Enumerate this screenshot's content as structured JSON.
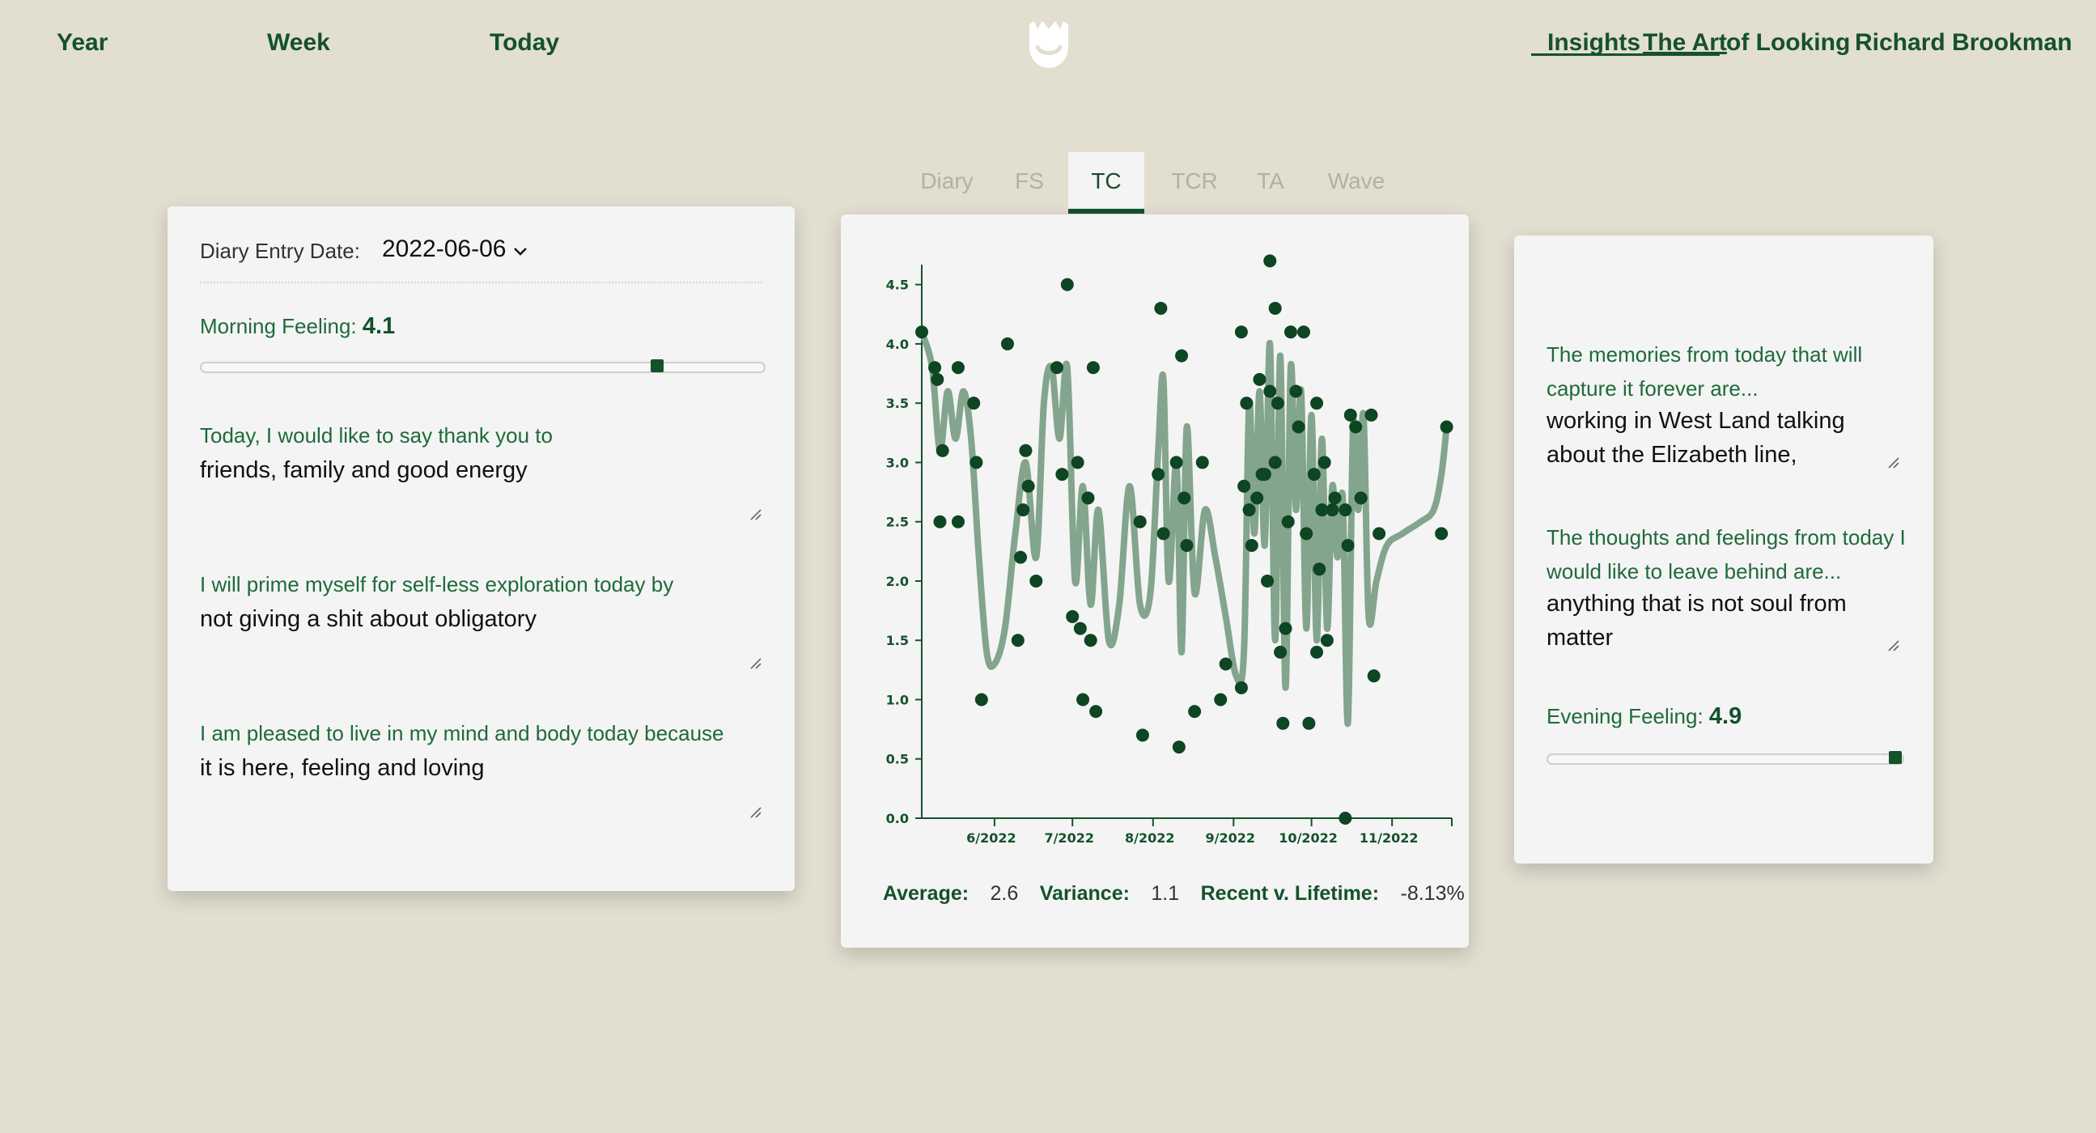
{
  "nav": {
    "year": "Year",
    "week": "Week",
    "today": "Today",
    "insights": "Insights",
    "art_of_looking_1": "The Art",
    "art_of_looking_2": "of Looking",
    "user": "Richard Brookman"
  },
  "tabs": [
    "Diary",
    "FS",
    "TC",
    "TCR",
    "TA",
    "Wave"
  ],
  "active_tab": "TC",
  "left": {
    "date_label": "Diary Entry Date:",
    "date_value": "2022-06-06",
    "morning_label": "Morning Feeling:",
    "morning_value": "4.1",
    "morning_slider_fraction": 0.81,
    "q1_label": "Today, I would like to say thank you to",
    "q1_value": "friends, family and good energy",
    "q2_label": "I will prime myself for self-less exploration today by",
    "q2_value": "not giving a shit about obligatory",
    "q3_label": "I am pleased to live in my mind and body today because",
    "q3_value": "it is here, feeling and loving"
  },
  "right": {
    "q1_label_line1": "The memories from today that will",
    "q1_label_line2": "capture it forever are...",
    "q1_value_line1": "working in West Land talking",
    "q1_value_line2": "about the Elizabeth line,",
    "q2_label_line1": "The thoughts and feelings from today I",
    "q2_label_line2": "would like to leave behind are...",
    "q2_value_line1": "anything that is not soul from",
    "q2_value_line2": "matter",
    "evening_label": "Evening Feeling:",
    "evening_value": "4.9",
    "evening_slider_fraction": 0.98
  },
  "stats": {
    "average_label": "Average:",
    "average_value": "2.6",
    "variance_label": "Variance:",
    "variance_value": "1.1",
    "recent_label": "Recent v. Lifetime:",
    "recent_value": "-8.13%"
  },
  "colors": {
    "accent": "#14522b",
    "line": "#83a48d",
    "background": "#e2ded0",
    "card": "#f4f4f4"
  },
  "chart_data": {
    "type": "scatter",
    "ylim": [
      0,
      4.6
    ],
    "yticks": [
      "0.0",
      "0.5",
      "1.0",
      "1.5",
      "2.0",
      "2.5",
      "3.0",
      "3.5",
      "4.0",
      "4.5"
    ],
    "xlim": [
      "2022-05-04",
      "2022-11-24"
    ],
    "xticks": [
      {
        "date": "2022-06-01",
        "label": "6/2022"
      },
      {
        "date": "2022-07-01",
        "label": "7/2022"
      },
      {
        "date": "2022-08-01",
        "label": "8/2022"
      },
      {
        "date": "2022-09-01",
        "label": "9/2022"
      },
      {
        "date": "2022-10-01",
        "label": "10/2022"
      },
      {
        "date": "2022-11-01",
        "label": "11/2022"
      }
    ],
    "points": [
      [
        "2022-05-04",
        4.1
      ],
      [
        "2022-05-09",
        3.8
      ],
      [
        "2022-05-10",
        3.7
      ],
      [
        "2022-05-11",
        2.5
      ],
      [
        "2022-05-12",
        3.1
      ],
      [
        "2022-05-18",
        2.5
      ],
      [
        "2022-05-18",
        3.8
      ],
      [
        "2022-05-24",
        3.5
      ],
      [
        "2022-05-25",
        3.0
      ],
      [
        "2022-05-27",
        1.0
      ],
      [
        "2022-06-06",
        4.0
      ],
      [
        "2022-06-10",
        1.5
      ],
      [
        "2022-06-11",
        2.2
      ],
      [
        "2022-06-12",
        2.6
      ],
      [
        "2022-06-13",
        3.1
      ],
      [
        "2022-06-14",
        2.8
      ],
      [
        "2022-06-17",
        2.0
      ],
      [
        "2022-06-25",
        3.8
      ],
      [
        "2022-06-27",
        2.9
      ],
      [
        "2022-06-29",
        4.5
      ],
      [
        "2022-07-01",
        1.7
      ],
      [
        "2022-07-03",
        3.0
      ],
      [
        "2022-07-04",
        1.6
      ],
      [
        "2022-07-05",
        1.0
      ],
      [
        "2022-07-07",
        2.7
      ],
      [
        "2022-07-08",
        1.5
      ],
      [
        "2022-07-09",
        3.8
      ],
      [
        "2022-07-10",
        0.9
      ],
      [
        "2022-07-27",
        2.5
      ],
      [
        "2022-07-28",
        0.7
      ],
      [
        "2022-08-03",
        2.9
      ],
      [
        "2022-08-04",
        4.3
      ],
      [
        "2022-08-05",
        2.4
      ],
      [
        "2022-08-10",
        3.0
      ],
      [
        "2022-08-11",
        0.6
      ],
      [
        "2022-08-12",
        3.9
      ],
      [
        "2022-08-13",
        2.7
      ],
      [
        "2022-08-14",
        2.3
      ],
      [
        "2022-08-17",
        0.9
      ],
      [
        "2022-08-20",
        3.0
      ],
      [
        "2022-08-27",
        1.0
      ],
      [
        "2022-08-29",
        1.3
      ],
      [
        "2022-09-04",
        1.1
      ],
      [
        "2022-09-04",
        4.1
      ],
      [
        "2022-09-05",
        2.8
      ],
      [
        "2022-09-06",
        3.5
      ],
      [
        "2022-09-07",
        2.6
      ],
      [
        "2022-09-08",
        2.3
      ],
      [
        "2022-09-10",
        2.7
      ],
      [
        "2022-09-11",
        3.7
      ],
      [
        "2022-09-12",
        2.9
      ],
      [
        "2022-09-13",
        2.9
      ],
      [
        "2022-09-14",
        2.0
      ],
      [
        "2022-09-15",
        3.6
      ],
      [
        "2022-09-15",
        4.7
      ],
      [
        "2022-09-17",
        3.0
      ],
      [
        "2022-09-17",
        4.3
      ],
      [
        "2022-09-18",
        3.5
      ],
      [
        "2022-09-19",
        1.4
      ],
      [
        "2022-09-20",
        0.8
      ],
      [
        "2022-09-21",
        1.6
      ],
      [
        "2022-09-22",
        2.5
      ],
      [
        "2022-09-23",
        4.1
      ],
      [
        "2022-09-25",
        3.6
      ],
      [
        "2022-09-26",
        3.3
      ],
      [
        "2022-09-28",
        4.1
      ],
      [
        "2022-09-29",
        2.4
      ],
      [
        "2022-09-30",
        0.8
      ],
      [
        "2022-10-02",
        2.9
      ],
      [
        "2022-10-03",
        1.4
      ],
      [
        "2022-10-03",
        3.5
      ],
      [
        "2022-10-04",
        2.1
      ],
      [
        "2022-10-05",
        2.6
      ],
      [
        "2022-10-06",
        3.0
      ],
      [
        "2022-10-07",
        1.5
      ],
      [
        "2022-10-09",
        2.6
      ],
      [
        "2022-10-10",
        2.7
      ],
      [
        "2022-10-14",
        2.6
      ],
      [
        "2022-10-14",
        0.0
      ],
      [
        "2022-10-15",
        2.3
      ],
      [
        "2022-10-16",
        3.4
      ],
      [
        "2022-10-18",
        3.3
      ],
      [
        "2022-10-20",
        2.7
      ],
      [
        "2022-10-24",
        3.4
      ],
      [
        "2022-10-25",
        1.2
      ],
      [
        "2022-10-27",
        2.4
      ],
      [
        "2022-11-20",
        2.4
      ],
      [
        "2022-11-22",
        3.3
      ]
    ],
    "trend_line": [
      [
        "2022-05-04",
        4.1
      ],
      [
        "2022-05-08",
        3.8
      ],
      [
        "2022-05-11",
        3.1
      ],
      [
        "2022-05-14",
        3.6
      ],
      [
        "2022-05-17",
        3.2
      ],
      [
        "2022-05-20",
        3.6
      ],
      [
        "2022-05-23",
        3.2
      ],
      [
        "2022-05-26",
        2.2
      ],
      [
        "2022-05-29",
        1.4
      ],
      [
        "2022-06-01",
        1.3
      ],
      [
        "2022-06-05",
        1.6
      ],
      [
        "2022-06-09",
        2.4
      ],
      [
        "2022-06-13",
        3.0
      ],
      [
        "2022-06-17",
        2.2
      ],
      [
        "2022-06-20",
        3.5
      ],
      [
        "2022-06-23",
        3.8
      ],
      [
        "2022-06-26",
        3.2
      ],
      [
        "2022-06-29",
        3.8
      ],
      [
        "2022-07-02",
        2.0
      ],
      [
        "2022-07-05",
        2.8
      ],
      [
        "2022-07-08",
        1.8
      ],
      [
        "2022-07-11",
        2.6
      ],
      [
        "2022-07-15",
        1.5
      ],
      [
        "2022-07-19",
        1.8
      ],
      [
        "2022-07-23",
        2.8
      ],
      [
        "2022-07-27",
        1.8
      ],
      [
        "2022-07-31",
        1.9
      ],
      [
        "2022-08-03",
        3.1
      ],
      [
        "2022-08-05",
        3.7
      ],
      [
        "2022-08-07",
        2.0
      ],
      [
        "2022-08-10",
        3.0
      ],
      [
        "2022-08-12",
        1.4
      ],
      [
        "2022-08-14",
        3.3
      ],
      [
        "2022-08-17",
        1.9
      ],
      [
        "2022-08-21",
        2.6
      ],
      [
        "2022-08-25",
        2.2
      ],
      [
        "2022-08-29",
        1.7
      ],
      [
        "2022-09-02",
        1.2
      ],
      [
        "2022-09-05",
        1.4
      ],
      [
        "2022-09-07",
        3.5
      ],
      [
        "2022-09-09",
        2.4
      ],
      [
        "2022-09-11",
        3.6
      ],
      [
        "2022-09-13",
        2.3
      ],
      [
        "2022-09-15",
        4.0
      ],
      [
        "2022-09-17",
        1.5
      ],
      [
        "2022-09-19",
        3.9
      ],
      [
        "2022-09-21",
        1.1
      ],
      [
        "2022-09-23",
        3.8
      ],
      [
        "2022-09-25",
        2.6
      ],
      [
        "2022-09-27",
        3.6
      ],
      [
        "2022-09-29",
        1.6
      ],
      [
        "2022-10-01",
        3.4
      ],
      [
        "2022-10-03",
        1.5
      ],
      [
        "2022-10-05",
        3.2
      ],
      [
        "2022-10-07",
        1.6
      ],
      [
        "2022-10-09",
        2.8
      ],
      [
        "2022-10-11",
        2.2
      ],
      [
        "2022-10-13",
        2.7
      ],
      [
        "2022-10-15",
        0.8
      ],
      [
        "2022-10-17",
        3.3
      ],
      [
        "2022-10-19",
        2.6
      ],
      [
        "2022-10-21",
        3.4
      ],
      [
        "2022-10-23",
        1.7
      ],
      [
        "2022-10-26",
        2.0
      ],
      [
        "2022-10-30",
        2.3
      ],
      [
        "2022-11-05",
        2.4
      ],
      [
        "2022-11-12",
        2.5
      ],
      [
        "2022-11-17",
        2.6
      ],
      [
        "2022-11-20",
        2.9
      ],
      [
        "2022-11-22",
        3.3
      ]
    ]
  }
}
